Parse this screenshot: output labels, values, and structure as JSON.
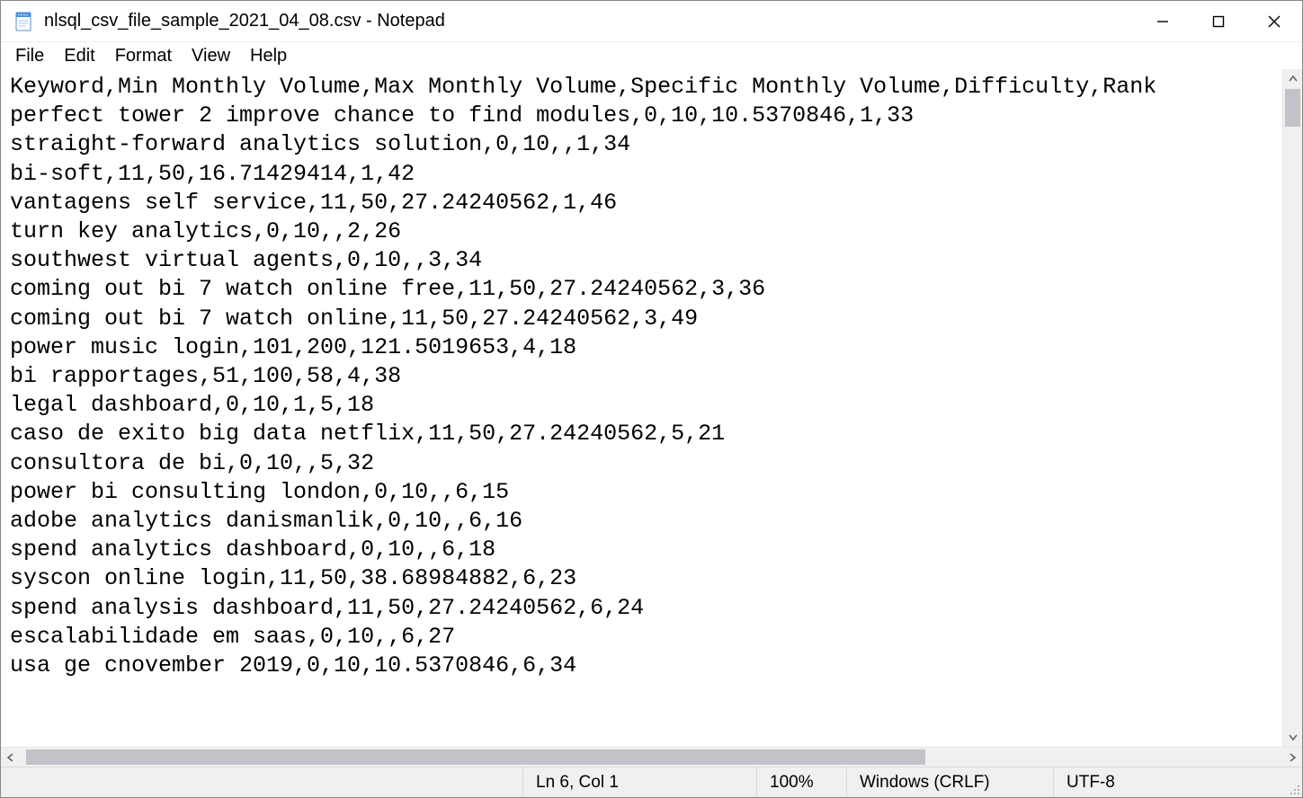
{
  "window": {
    "title": "nlsql_csv_file_sample_2021_04_08.csv - Notepad"
  },
  "menu": {
    "file": "File",
    "edit": "Edit",
    "format": "Format",
    "view": "View",
    "help": "Help"
  },
  "editor": {
    "lines": [
      "Keyword,Min Monthly Volume,Max Monthly Volume,Specific Monthly Volume,Difficulty,Rank",
      "perfect tower 2 improve chance to find modules,0,10,10.5370846,1,33",
      "straight-forward analytics solution,0,10,,1,34",
      "bi-soft,11,50,16.71429414,1,42",
      "vantagens self service,11,50,27.24240562,1,46",
      "turn key analytics,0,10,,2,26",
      "southwest virtual agents,0,10,,3,34",
      "coming out bi 7 watch online free,11,50,27.24240562,3,36",
      "coming out bi 7 watch online,11,50,27.24240562,3,49",
      "power music login,101,200,121.5019653,4,18",
      "bi rapportages,51,100,58,4,38",
      "legal dashboard,0,10,1,5,18",
      "caso de exito big data netflix,11,50,27.24240562,5,21",
      "consultora de bi,0,10,,5,32",
      "power bi consulting london,0,10,,6,15",
      "adobe analytics danismanlik,0,10,,6,16",
      "spend analytics dashboard,0,10,,6,18",
      "syscon online login,11,50,38.68984882,6,23",
      "spend analysis dashboard,11,50,27.24240562,6,24",
      "escalabilidade em saas,0,10,,6,27",
      "usa ge cnovember 2019,0,10,10.5370846,6,34"
    ]
  },
  "status": {
    "position": "Ln 6, Col 1",
    "zoom": "100%",
    "eol": "Windows (CRLF)",
    "encoding": "UTF-8"
  }
}
